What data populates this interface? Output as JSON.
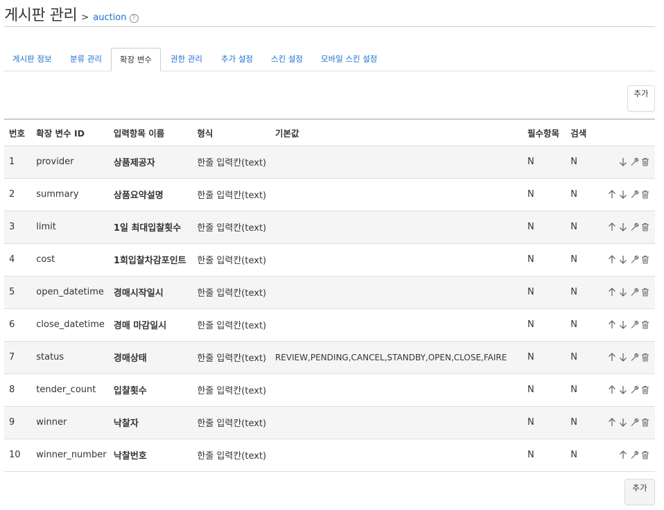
{
  "header": {
    "title": "게시판 관리",
    "crumb_sep": ">",
    "crumb_link": "auction",
    "help": "?"
  },
  "tabs": [
    {
      "label": "게시판 정보",
      "active": false
    },
    {
      "label": "분류 관리",
      "active": false
    },
    {
      "label": "확장 변수",
      "active": true
    },
    {
      "label": "권한 관리",
      "active": false
    },
    {
      "label": "추가 설정",
      "active": false
    },
    {
      "label": "스킨 설정",
      "active": false
    },
    {
      "label": "모바일 스킨 설정",
      "active": false
    }
  ],
  "buttons": {
    "add_top": "추가",
    "add_bottom": "추가"
  },
  "table": {
    "headers": [
      "번호",
      "확장 변수 ID",
      "입력항목 이름",
      "형식",
      "기본값",
      "필수항목",
      "검색",
      ""
    ],
    "rows": [
      {
        "no": "1",
        "id": "provider",
        "name": "상품제공자",
        "type": "한줄 입력칸(text)",
        "default": "",
        "required": "N",
        "search": "N",
        "up": false,
        "down": true
      },
      {
        "no": "2",
        "id": "summary",
        "name": "상품요약설명",
        "type": "한줄 입력칸(text)",
        "default": "",
        "required": "N",
        "search": "N",
        "up": true,
        "down": true
      },
      {
        "no": "3",
        "id": "limit",
        "name": "1일 최대입찰횟수",
        "type": "한줄 입력칸(text)",
        "default": "",
        "required": "N",
        "search": "N",
        "up": true,
        "down": true
      },
      {
        "no": "4",
        "id": "cost",
        "name": "1회입찰차감포인트",
        "type": "한줄 입력칸(text)",
        "default": "",
        "required": "N",
        "search": "N",
        "up": true,
        "down": true
      },
      {
        "no": "5",
        "id": "open_datetime",
        "name": "경매시작일시",
        "type": "한줄 입력칸(text)",
        "default": "",
        "required": "N",
        "search": "N",
        "up": true,
        "down": true
      },
      {
        "no": "6",
        "id": "close_datetime",
        "name": "경매 마감일시",
        "type": "한줄 입력칸(text)",
        "default": "",
        "required": "N",
        "search": "N",
        "up": true,
        "down": true
      },
      {
        "no": "7",
        "id": "status",
        "name": "경매상태",
        "type": "한줄 입력칸(text)",
        "default": "REVIEW,PENDING,CANCEL,STANDBY,OPEN,CLOSE,FAIRE",
        "required": "N",
        "search": "N",
        "up": true,
        "down": true
      },
      {
        "no": "8",
        "id": "tender_count",
        "name": "입찰횟수",
        "type": "한줄 입력칸(text)",
        "default": "",
        "required": "N",
        "search": "N",
        "up": true,
        "down": true
      },
      {
        "no": "9",
        "id": "winner",
        "name": "낙찰자",
        "type": "한줄 입력칸(text)",
        "default": "",
        "required": "N",
        "search": "N",
        "up": true,
        "down": true
      },
      {
        "no": "10",
        "id": "winner_number",
        "name": "낙찰번호",
        "type": "한줄 입력칸(text)",
        "default": "",
        "required": "N",
        "search": "N",
        "up": true,
        "down": false
      }
    ]
  },
  "icons": {
    "up": "arrow-up-icon",
    "down": "arrow-down-icon",
    "edit": "wrench-icon",
    "delete": "trash-icon"
  }
}
